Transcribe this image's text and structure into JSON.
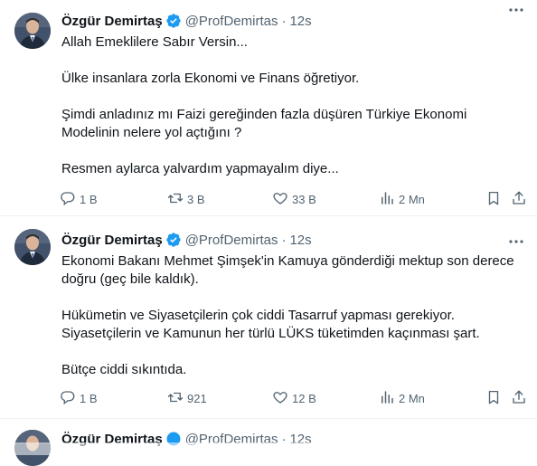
{
  "colors": {
    "text": "#0f1419",
    "secondary": "#536471",
    "verified": "#1d9bf0",
    "divider": "#eff3f4"
  },
  "tweets": [
    {
      "author": "Özgür Demirtaş",
      "handle": "@ProfDemirtas",
      "separator": "·",
      "time": "12s",
      "lines": [
        "Allah Emeklilere Sabır Versin...",
        "Ülke insanlara zorla Ekonomi ve Finans öğretiyor.",
        "Şimdi anladınız mı Faizi gereğinden fazla düşüren Türkiye Ekonomi Modelinin nelere yol açtığını ?",
        "Resmen aylarca yalvardım yapmayalım diye..."
      ],
      "replies": "1 B",
      "reposts": "3 B",
      "likes": "33 B",
      "views": "2 Mn"
    },
    {
      "author": "Özgür Demirtaş",
      "handle": "@ProfDemirtas",
      "separator": "·",
      "time": "12s",
      "lines": [
        "Ekonomi Bakanı Mehmet Şimşek'in Kamuya gönderdiği mektup son derece doğru (geç bile kaldık).",
        "Hükümetin ve Siyasetçilerin çok ciddi Tasarruf yapması gerekiyor. Siyasetçilerin ve Kamunun her türlü LÜKS tüketimden kaçınması şart.",
        "Bütçe ciddi sıkıntıda."
      ],
      "replies": "1 B",
      "reposts": "921",
      "likes": "12 B",
      "views": "2 Mn"
    },
    {
      "author": "Özgür Demirtaş",
      "handle": "@ProfDemirtas",
      "separator": "·",
      "time": "12s"
    }
  ],
  "icons": {
    "reply": "reply-icon",
    "repost": "repost-icon",
    "like": "heart-icon",
    "views": "views-chart-icon",
    "bookmark": "bookmark-icon",
    "share": "share-icon",
    "more": "more-dots-icon",
    "verified": "verified-badge-icon"
  }
}
